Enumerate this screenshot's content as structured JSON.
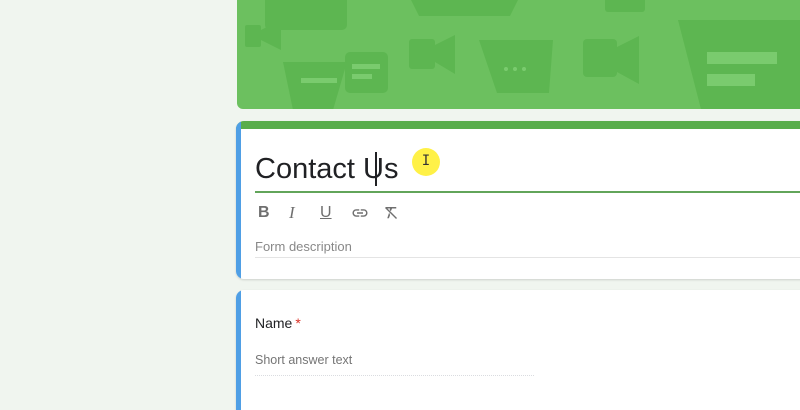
{
  "form": {
    "title": "Contact Us",
    "description_placeholder": "Form description"
  },
  "toolbar": {
    "bold": "B",
    "italic": "I",
    "underline": "U",
    "link_icon": "link-icon",
    "clear_format_icon": "clear-format-icon"
  },
  "cursor": {
    "glyph": "I"
  },
  "question": {
    "title": "Name",
    "required_mark": "*",
    "answer_placeholder": "Short answer text"
  },
  "colors": {
    "page_background": "#f0f5ef",
    "header_green": "#6cc05f",
    "accent_green": "#58ad4b",
    "focus_blue": "#4f9fe5",
    "required_red": "#d93025"
  }
}
